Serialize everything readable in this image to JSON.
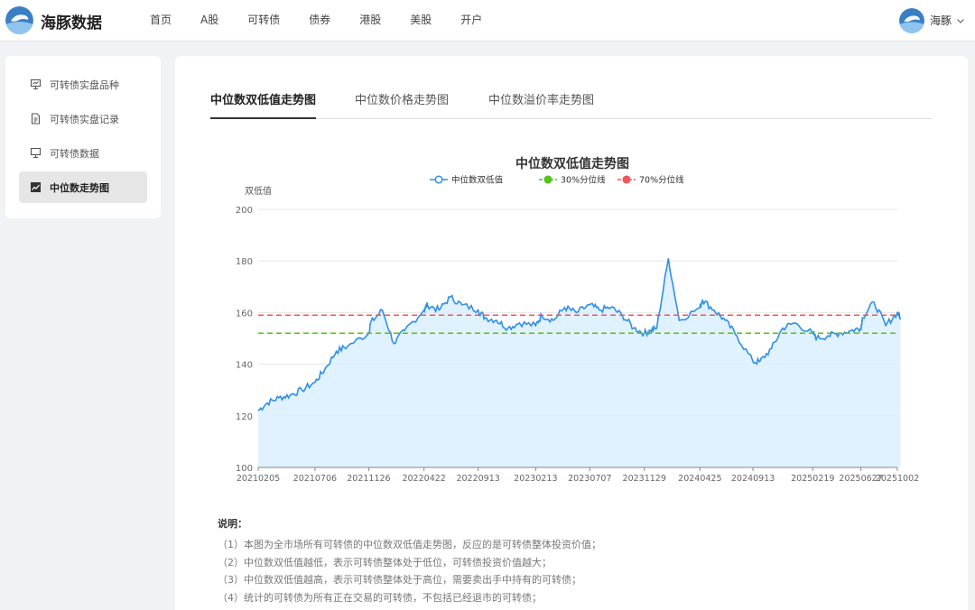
{
  "header": {
    "brand": "海豚数据",
    "nav": [
      "首页",
      "A股",
      "可转债",
      "债券",
      "港股",
      "美股",
      "开户"
    ],
    "user_name": "海豚"
  },
  "sidebar": {
    "items": [
      {
        "label": "可转债实盘品种",
        "icon": "chart-board-icon",
        "active": false
      },
      {
        "label": "可转债实盘记录",
        "icon": "document-icon",
        "active": false
      },
      {
        "label": "可转债数据",
        "icon": "board-icon",
        "active": false
      },
      {
        "label": "中位数走势图",
        "icon": "line-chart-icon",
        "active": true
      }
    ]
  },
  "tabs": [
    {
      "label": "中位数双低值走势图",
      "active": true
    },
    {
      "label": "中位数价格走势图",
      "active": false
    },
    {
      "label": "中位数溢价率走势图",
      "active": false
    }
  ],
  "colors": {
    "series": "#2f8fe8",
    "area": "#dbeeff",
    "p30": "#52c41a",
    "p70": "#f0565d"
  },
  "chart_data": {
    "type": "area",
    "title": "中位数双低值走势图",
    "ylabel": "双低值",
    "ylim": [
      100,
      200
    ],
    "yticks": [
      100,
      120,
      140,
      160,
      180,
      200
    ],
    "xticks": [
      "20210205",
      "20210706",
      "20211126",
      "20220422",
      "20220913",
      "20230213",
      "20230707",
      "20231129",
      "20240425",
      "20240913",
      "20250219",
      "20250627",
      "20251002"
    ],
    "legend": [
      "中位数双低值",
      "30%分位线",
      "70%分位线"
    ],
    "legend_position": "top-center",
    "grid": "horizontal",
    "p30_value": 152,
    "p70_value": 159,
    "series": [
      {
        "name": "中位数双低值",
        "dates": [
          "20210205",
          "20210301",
          "20210401",
          "20210501",
          "20210601",
          "20210706",
          "20210801",
          "20210901",
          "20211001",
          "20211126",
          "20211201",
          "20220101",
          "20220201",
          "20220301",
          "20220422",
          "20220501",
          "20220601",
          "20220701",
          "20220801",
          "20220913",
          "20221001",
          "20221101",
          "20221201",
          "20230101",
          "20230213",
          "20230301",
          "20230401",
          "20230501",
          "20230601",
          "20230707",
          "20230801",
          "20230901",
          "20231001",
          "20231101",
          "20231129",
          "20231215",
          "20240101",
          "20240201",
          "20240301",
          "20240425",
          "20240501",
          "20240601",
          "20240701",
          "20240801",
          "20240913",
          "20241001",
          "20241101",
          "20241201",
          "20250101",
          "20250219",
          "20250301",
          "20250401",
          "20250501",
          "20250601",
          "20250627",
          "20250701",
          "20250801",
          "20250901",
          "20251002",
          "20251010"
        ],
        "values": [
          122,
          125,
          127,
          128,
          130,
          133,
          138,
          145,
          147,
          152,
          156,
          161,
          148,
          153,
          161,
          163,
          161,
          166,
          163,
          161,
          158,
          157,
          154,
          156,
          155,
          159,
          157,
          162,
          160,
          163,
          161,
          162,
          159,
          154,
          152,
          153,
          154,
          181,
          157,
          162,
          165,
          161,
          157,
          151,
          141,
          141,
          146,
          154,
          156,
          152,
          150,
          151,
          152,
          153,
          154,
          158,
          164,
          155,
          160,
          158
        ]
      }
    ]
  },
  "notes": {
    "title": "说明：",
    "items": [
      "（1）本图为全市场所有可转债的中位数双低值走势图，反应的是可转债整体投资价值；",
      "（2）中位数双低值越低，表示可转债整体处于低位，可转债投资价值越大；",
      "（3）中位数双低值越高，表示可转债整体处于高位，需要卖出手中持有的可转债；",
      "（4）统计的可转债为所有正在交易的可转债，不包括已经退市的可转债；"
    ]
  }
}
